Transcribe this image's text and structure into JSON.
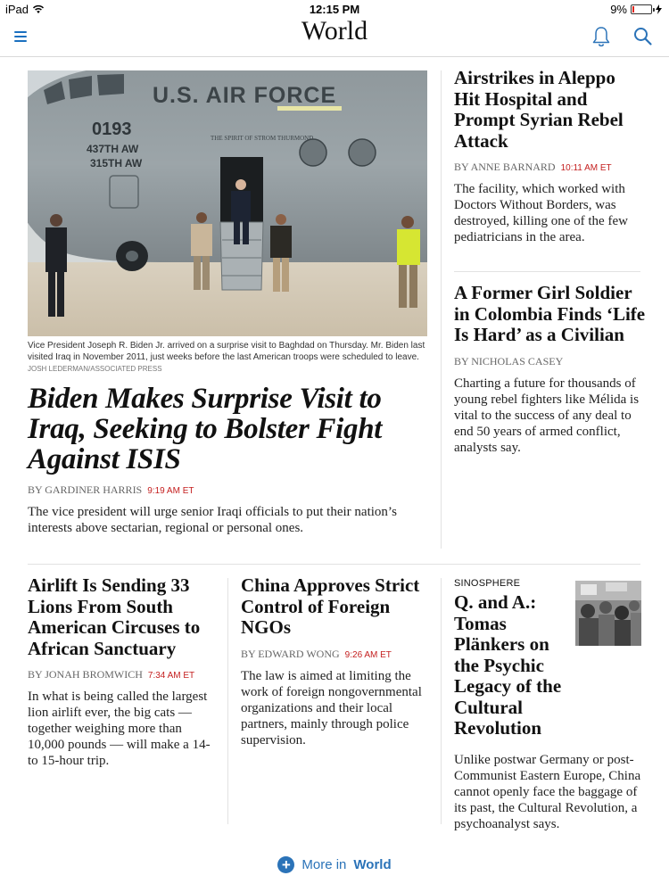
{
  "status_bar": {
    "device": "iPad",
    "time": "12:15 PM",
    "battery": "9%",
    "battery_level": 0.09
  },
  "nav": {
    "title": "World",
    "menu_icon": "hamburger-menu-icon",
    "bell_icon": "bell-icon",
    "search_icon": "search-icon"
  },
  "lead_story": {
    "caption": "Vice President Joseph R. Biden Jr. arrived on a surprise visit to Baghdad on Thursday. Mr. Biden last visited Iraq in November 2011, just weeks before the last American troops were scheduled to leave.",
    "credit": "JOSH LEDERMAN/ASSOCIATED PRESS",
    "photo": {
      "tail_text": "U.S. AIR FORCE",
      "tail_number": "0193",
      "wing_1": "437TH AW",
      "wing_2": "315TH AW",
      "aircraft_name": "THE SPIRIT OF STROM THURMOND"
    },
    "headline": "Biden Makes Surprise Visit to Iraq, Seeking to Bolster Fight Against ISIS",
    "byline": "By GARDINER HARRIS",
    "time": "9:19 AM ET",
    "summary": "The vice president will urge senior Iraqi officials to put their nation’s interests above sectarian, regional or personal ones."
  },
  "side_stories": [
    {
      "headline": "Airstrikes in Aleppo Hit Hospital and Prompt Syrian Rebel Attack",
      "byline": "By ANNE BARNARD",
      "time": "10:11 AM ET",
      "summary": "The facility, which worked with Doctors Without Borders, was destroyed, killing one of the few pediatricians in the area."
    },
    {
      "headline": "A Former Girl Soldier in Colombia Finds ‘Life Is Hard’ as a Civilian",
      "byline": "By NICHOLAS CASEY",
      "time": "",
      "summary": "Charting a future for thousands of young rebel fighters like Mélida is vital to the success of any deal to end 50 years of armed conflict, analysts say."
    }
  ],
  "bottom_stories": [
    {
      "headline": "Airlift Is Sending 33 Lions From South American Circuses to African Sanctuary",
      "byline": "By JONAH BROMWICH",
      "time": "7:34 AM ET",
      "summary": "In what is being called the largest lion airlift ever, the big cats — together weighing more than 10,000 pounds — will make a 14- to 15-hour trip."
    },
    {
      "headline": "China Approves Strict Control of Foreign NGOs",
      "byline": "By EDWARD WONG",
      "time": "9:26 AM ET",
      "summary": "The law is aimed at limiting the work of foreign nongovernmental organizations and their local partners, mainly through police supervision."
    },
    {
      "kicker": "SINOSPHERE",
      "headline": "Q. and A.: Tomas Plänkers on the Psychic Legacy of the Cultural Revolution",
      "summary": "Unlike postwar Germany or post-Communist Eastern Europe, China cannot openly face the baggage of its past, the Cultural Revolution, a psychoanalyst says."
    }
  ],
  "more_link": {
    "prefix": "More in",
    "section": "World"
  },
  "colors": {
    "accent": "#2b73b8",
    "time": "#c41e1e",
    "divider": "#e2e2e2"
  }
}
